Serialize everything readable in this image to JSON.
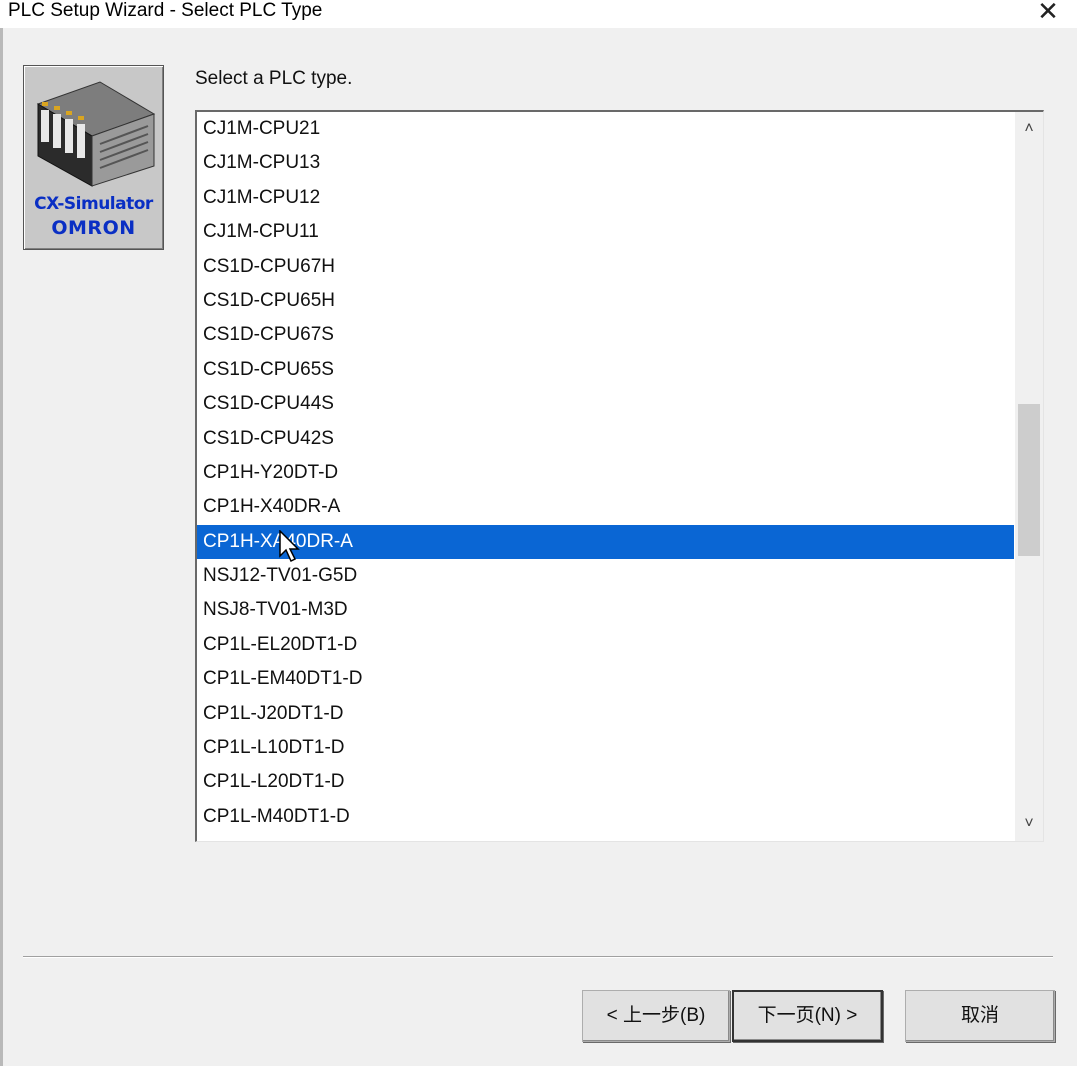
{
  "window": {
    "title": "PLC Setup Wizard - Select PLC Type",
    "close_glyph": "✕"
  },
  "logo": {
    "product": "CX-Simulator",
    "brand": "OMRON",
    "icon": "plc-rack-icon"
  },
  "prompt": "Select a PLC type.",
  "plc_list": {
    "selected_index": 12,
    "items": [
      "CJ1M-CPU21",
      "CJ1M-CPU13",
      "CJ1M-CPU12",
      "CJ1M-CPU11",
      "CS1D-CPU67H",
      "CS1D-CPU65H",
      "CS1D-CPU67S",
      "CS1D-CPU65S",
      "CS1D-CPU44S",
      "CS1D-CPU42S",
      "CP1H-Y20DT-D",
      "CP1H-X40DR-A",
      "CP1H-XA40DR-A",
      "NSJ12-TV01-G5D",
      "NSJ8-TV01-M3D",
      "CP1L-EL20DT1-D",
      "CP1L-EM40DT1-D",
      "CP1L-J20DT1-D",
      "CP1L-L10DT1-D",
      "CP1L-L20DT1-D",
      "CP1L-M40DT1-D"
    ],
    "scroll": {
      "up_glyph": "˄",
      "down_glyph": "˅",
      "thumb_start_fraction": 0.39,
      "thumb_size_fraction": 0.23
    }
  },
  "buttons": {
    "back": "< 上一步(B)",
    "next": "下一页(N) >",
    "cancel": "取消"
  },
  "colors": {
    "selection": "#0a66d4",
    "logo_text": "#0a2fc4"
  }
}
